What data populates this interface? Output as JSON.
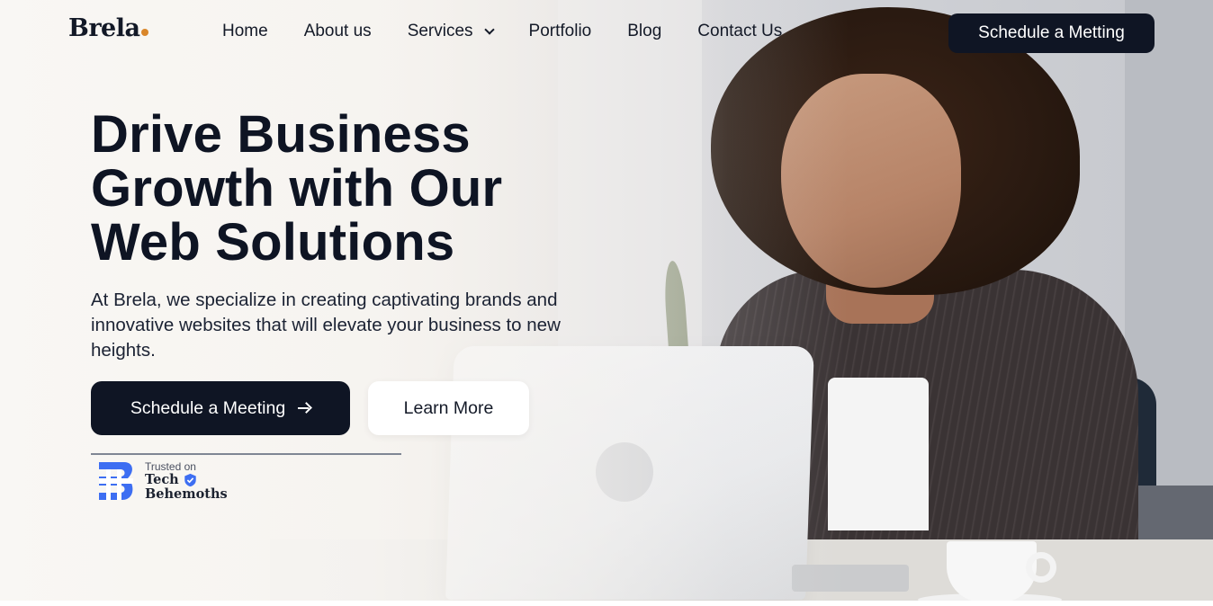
{
  "brand": {
    "name": "Brela",
    "accent_dot_color": "#d9862a"
  },
  "nav": {
    "links": [
      "Home",
      "About us",
      "Services",
      "Portfolio",
      "Blog",
      "Contact Us"
    ],
    "services_dropdown_icon": "chevron-down-icon",
    "cta_label": "Schedule a Metting"
  },
  "hero": {
    "headline": [
      "Drive Business",
      "Growth with Our",
      "Web Solutions"
    ],
    "description": "At Brela, we specialize in creating captivating brands and innovative websites that will elevate your business to new heights.",
    "primary_button": {
      "label": "Schedule a Meeting",
      "icon": "arrow-right-icon"
    },
    "secondary_button": {
      "label": "Learn More"
    }
  },
  "badge": {
    "prefix": "Trusted on",
    "name_line1": "Tech",
    "name_line2": "Behemoths",
    "verified_icon": "shield-check-icon",
    "logo_color": "#3d6ef2"
  },
  "colors": {
    "dark": "#0f1524",
    "text": "#0e1423",
    "white": "#ffffff"
  }
}
